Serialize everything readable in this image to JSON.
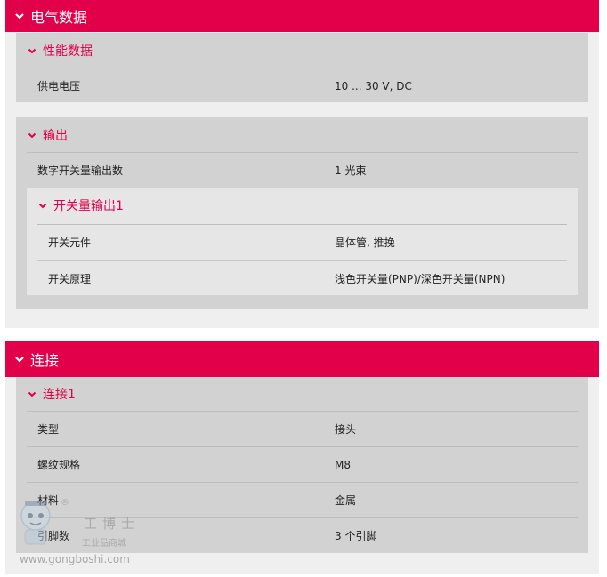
{
  "sections": {
    "electrical": {
      "title": "电气数据",
      "performance": {
        "title": "性能数据",
        "rows": [
          {
            "label": "供电电压",
            "value": "10 ... 30 V, DC"
          }
        ]
      },
      "output": {
        "title": "输出",
        "rows": [
          {
            "label": "数字开关量输出数",
            "value": "1 光束"
          }
        ],
        "switch_output": {
          "title": "开关量输出1",
          "rows": [
            {
              "label": "开关元件",
              "value": "晶体管, 推挽"
            },
            {
              "label": "开关原理",
              "value": "浅色开关量(PNP)/深色开关量(NPN)"
            }
          ]
        }
      }
    },
    "connection": {
      "title": "连接",
      "conn1": {
        "title": "连接1",
        "rows": [
          {
            "label": "类型",
            "value": "接头"
          },
          {
            "label": "螺纹规格",
            "value": "M8"
          },
          {
            "label": "材料",
            "value": "金属"
          },
          {
            "label": "引脚数",
            "value": "3 个引脚"
          }
        ]
      }
    }
  },
  "watermark": {
    "brand": "工博士",
    "tagline": "工业品商城",
    "url": "www.gongboshi.com",
    "registered": "®"
  },
  "colors": {
    "accent": "#e2004a",
    "panel": "#d2d2d2",
    "inner_panel": "#e6e6e6",
    "section_bg": "#efefef"
  }
}
